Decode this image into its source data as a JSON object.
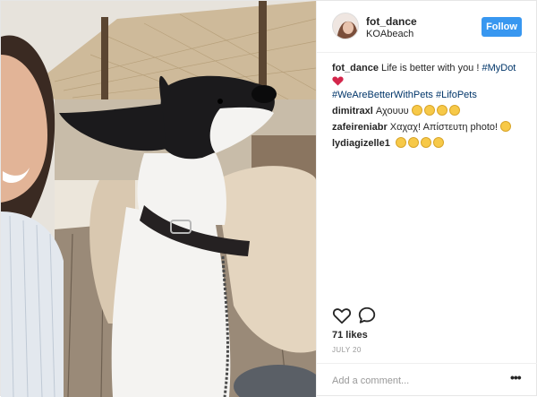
{
  "header": {
    "username": "fot_dance",
    "location": "KOAbeach",
    "follow_label": "Follow"
  },
  "caption": {
    "user": "fot_dance",
    "text": "Life is better with you ! ",
    "tags": [
      "#MyDot",
      "#WeAreBetterWithPets",
      "#LifoPets"
    ]
  },
  "comments": [
    {
      "user": "dimitraxl",
      "text": "Αχουυυ"
    },
    {
      "user": "zafeireniabr",
      "text": "Χαχαχ! Απίστευτη photo!"
    },
    {
      "user": "lydiagizelle1",
      "text": ""
    }
  ],
  "actions": {
    "likes": "71 likes",
    "date": "JULY 20"
  },
  "add_comment": {
    "placeholder": "Add a comment...",
    "more_label": "•••"
  },
  "icons": [
    "heart-icon",
    "comment-icon",
    "more-options-icon"
  ],
  "colors": {
    "follow_bg": "#3897f0",
    "hashtag": "#003569",
    "muted": "#999999"
  }
}
